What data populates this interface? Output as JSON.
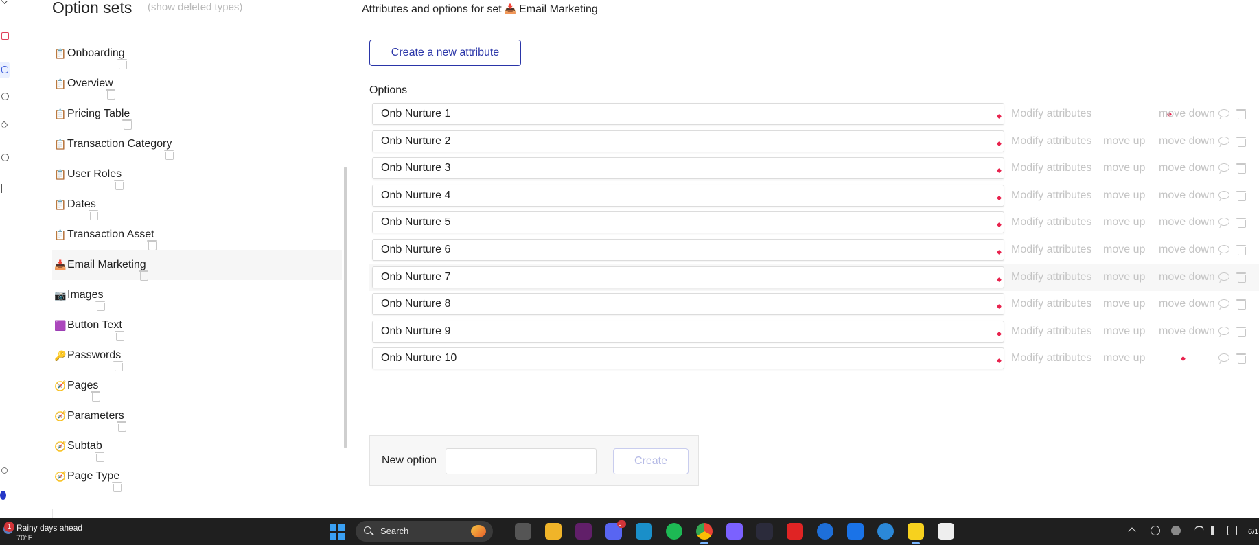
{
  "left_panel": {
    "title": "Option sets",
    "show_deleted": "(show deleted types)",
    "option_sets": [
      {
        "emoji": "📋",
        "name": "Onboarding"
      },
      {
        "emoji": "📋",
        "name": "Overview"
      },
      {
        "emoji": "📋",
        "name": "Pricing Table"
      },
      {
        "emoji": "📋",
        "name": "Transaction Category"
      },
      {
        "emoji": "📋",
        "name": "User Roles"
      },
      {
        "emoji": "📋",
        "name": "Dates"
      },
      {
        "emoji": "📋",
        "name": "Transaction Asset"
      },
      {
        "emoji": "📥",
        "name": "Email Marketing",
        "selected": true
      },
      {
        "emoji": "📷",
        "name": "Images"
      },
      {
        "emoji": "🟪",
        "name": "Button Text"
      },
      {
        "emoji": "🔑",
        "name": "Passwords"
      },
      {
        "emoji": "🧭",
        "name": "Pages"
      },
      {
        "emoji": "🧭",
        "name": "Parameters"
      },
      {
        "emoji": "🧭",
        "name": "Subtab"
      },
      {
        "emoji": "🧭",
        "name": "Page Type"
      }
    ]
  },
  "main": {
    "title_prefix": "Attributes and options for set",
    "title_emoji": "📥",
    "title_set": "Email Marketing",
    "create_attribute_label": "Create a new attribute",
    "options_label": "Options",
    "modify_label": "Modify attributes",
    "move_up_label": "move up",
    "move_down_label": "move down",
    "options": [
      {
        "value": "Onb Nurture 1",
        "move_up": false,
        "move_down": true
      },
      {
        "value": "Onb Nurture 2",
        "move_up": true,
        "move_down": true
      },
      {
        "value": "Onb Nurture 3",
        "move_up": true,
        "move_down": true
      },
      {
        "value": "Onb Nurture 4",
        "move_up": true,
        "move_down": true
      },
      {
        "value": "Onb Nurture 5",
        "move_up": true,
        "move_down": true
      },
      {
        "value": "Onb Nurture 6",
        "move_up": true,
        "move_down": true
      },
      {
        "value": "Onb Nurture 7",
        "move_up": true,
        "move_down": true,
        "highlighted": true
      },
      {
        "value": "Onb Nurture 8",
        "move_up": true,
        "move_down": true
      },
      {
        "value": "Onb Nurture 9",
        "move_up": true,
        "move_down": true
      },
      {
        "value": "Onb Nurture 10",
        "move_up": true,
        "move_down": false
      }
    ],
    "new_option_label": "New option",
    "new_option_value": "",
    "create_label": "Create"
  },
  "colors": {
    "accent": "#2a35a8",
    "indicator": "#e8224d",
    "muted": "#c4c4c4"
  },
  "taskbar": {
    "weather_badge": "1",
    "weather_title": "Rainy days ahead",
    "weather_temp": "70°F",
    "search_label": "Search",
    "discord_badge": "9+",
    "clock_partial": "6/1"
  }
}
